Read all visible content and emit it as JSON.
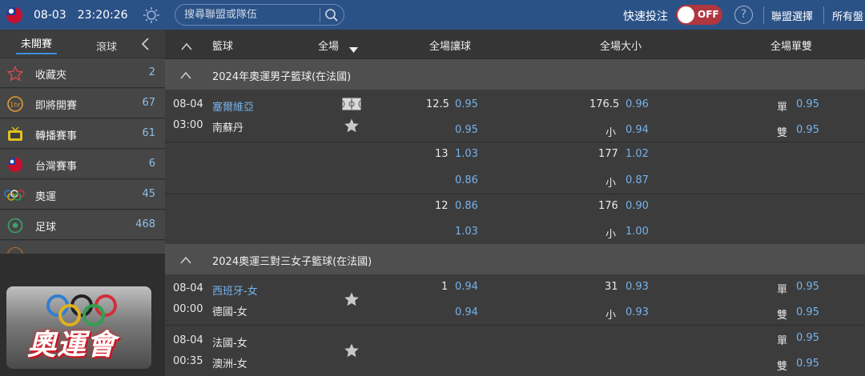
{
  "topbar": {
    "date": "08-03",
    "time": "23:20:26",
    "search_placeholder": "搜尋聯盟或隊伍",
    "quick_bet_label": "快速投注",
    "toggle_label": "OFF",
    "help_label": "?",
    "league_select_label": "聯盟選擇",
    "all_markets_label": "所有盤"
  },
  "sidebar": {
    "tabs": [
      {
        "label": "未開賽"
      },
      {
        "label": "滾球"
      }
    ],
    "items": [
      {
        "label": "收藏夾",
        "count": "2",
        "icon": "star-icon"
      },
      {
        "label": "即將開賽",
        "count": "67",
        "icon": "clock-1hr-icon"
      },
      {
        "label": "轉播賽事",
        "count": "61",
        "icon": "tv-icon"
      },
      {
        "label": "台灣賽事",
        "count": "6",
        "icon": "taiwan-flag-icon"
      },
      {
        "label": "奧運",
        "count": "45",
        "icon": "olympic-rings-icon"
      },
      {
        "label": "足球",
        "count": "468",
        "icon": "soccer-ball-icon"
      }
    ],
    "banner_text": "奧運會"
  },
  "columns": {
    "sport": "籃球",
    "period": "全場",
    "handicap": "全場讓球",
    "over_under": "全場大小",
    "odd_even": "全場單雙"
  },
  "leagues": [
    {
      "name": "2024年奧運男子籃球(在法國)",
      "matches": [
        {
          "date": "08-04",
          "time": "03:00",
          "home": "塞爾維亞",
          "away": "南蘇丹",
          "lines": [
            {
              "hdp": "12.5",
              "hdp_home": "0.95",
              "hdp_away": "0.95",
              "ou": "176.5",
              "over": "0.96",
              "under_label": "小",
              "under": "0.94",
              "odd_label": "單",
              "odd": "0.95",
              "even_label": "雙",
              "even": "0.95"
            },
            {
              "hdp": "13",
              "hdp_home": "1.03",
              "hdp_away": "0.86",
              "ou": "177",
              "over": "1.02",
              "under_label": "小",
              "under": "0.87"
            },
            {
              "hdp": "12",
              "hdp_home": "0.86",
              "hdp_away": "1.03",
              "ou": "176",
              "over": "0.90",
              "under_label": "小",
              "under": "1.00"
            }
          ]
        }
      ]
    },
    {
      "name": "2024奧運三對三女子籃球(在法國)",
      "matches": [
        {
          "date": "08-04",
          "time": "00:00",
          "home": "西班牙-女",
          "away": "德國-女",
          "lines": [
            {
              "hdp": "1",
              "hdp_home": "0.94",
              "hdp_away": "0.94",
              "ou": "31",
              "over": "0.93",
              "under_label": "小",
              "under": "0.93",
              "odd_label": "單",
              "odd": "0.95",
              "even_label": "雙",
              "even": "0.95"
            }
          ]
        },
        {
          "date": "08-04",
          "time": "00:35",
          "home": "法國-女",
          "away": "澳洲-女",
          "lines": [
            {
              "odd_label": "單",
              "odd": "0.95",
              "even_label": "雙",
              "even": "0.95"
            }
          ]
        }
      ]
    }
  ]
}
